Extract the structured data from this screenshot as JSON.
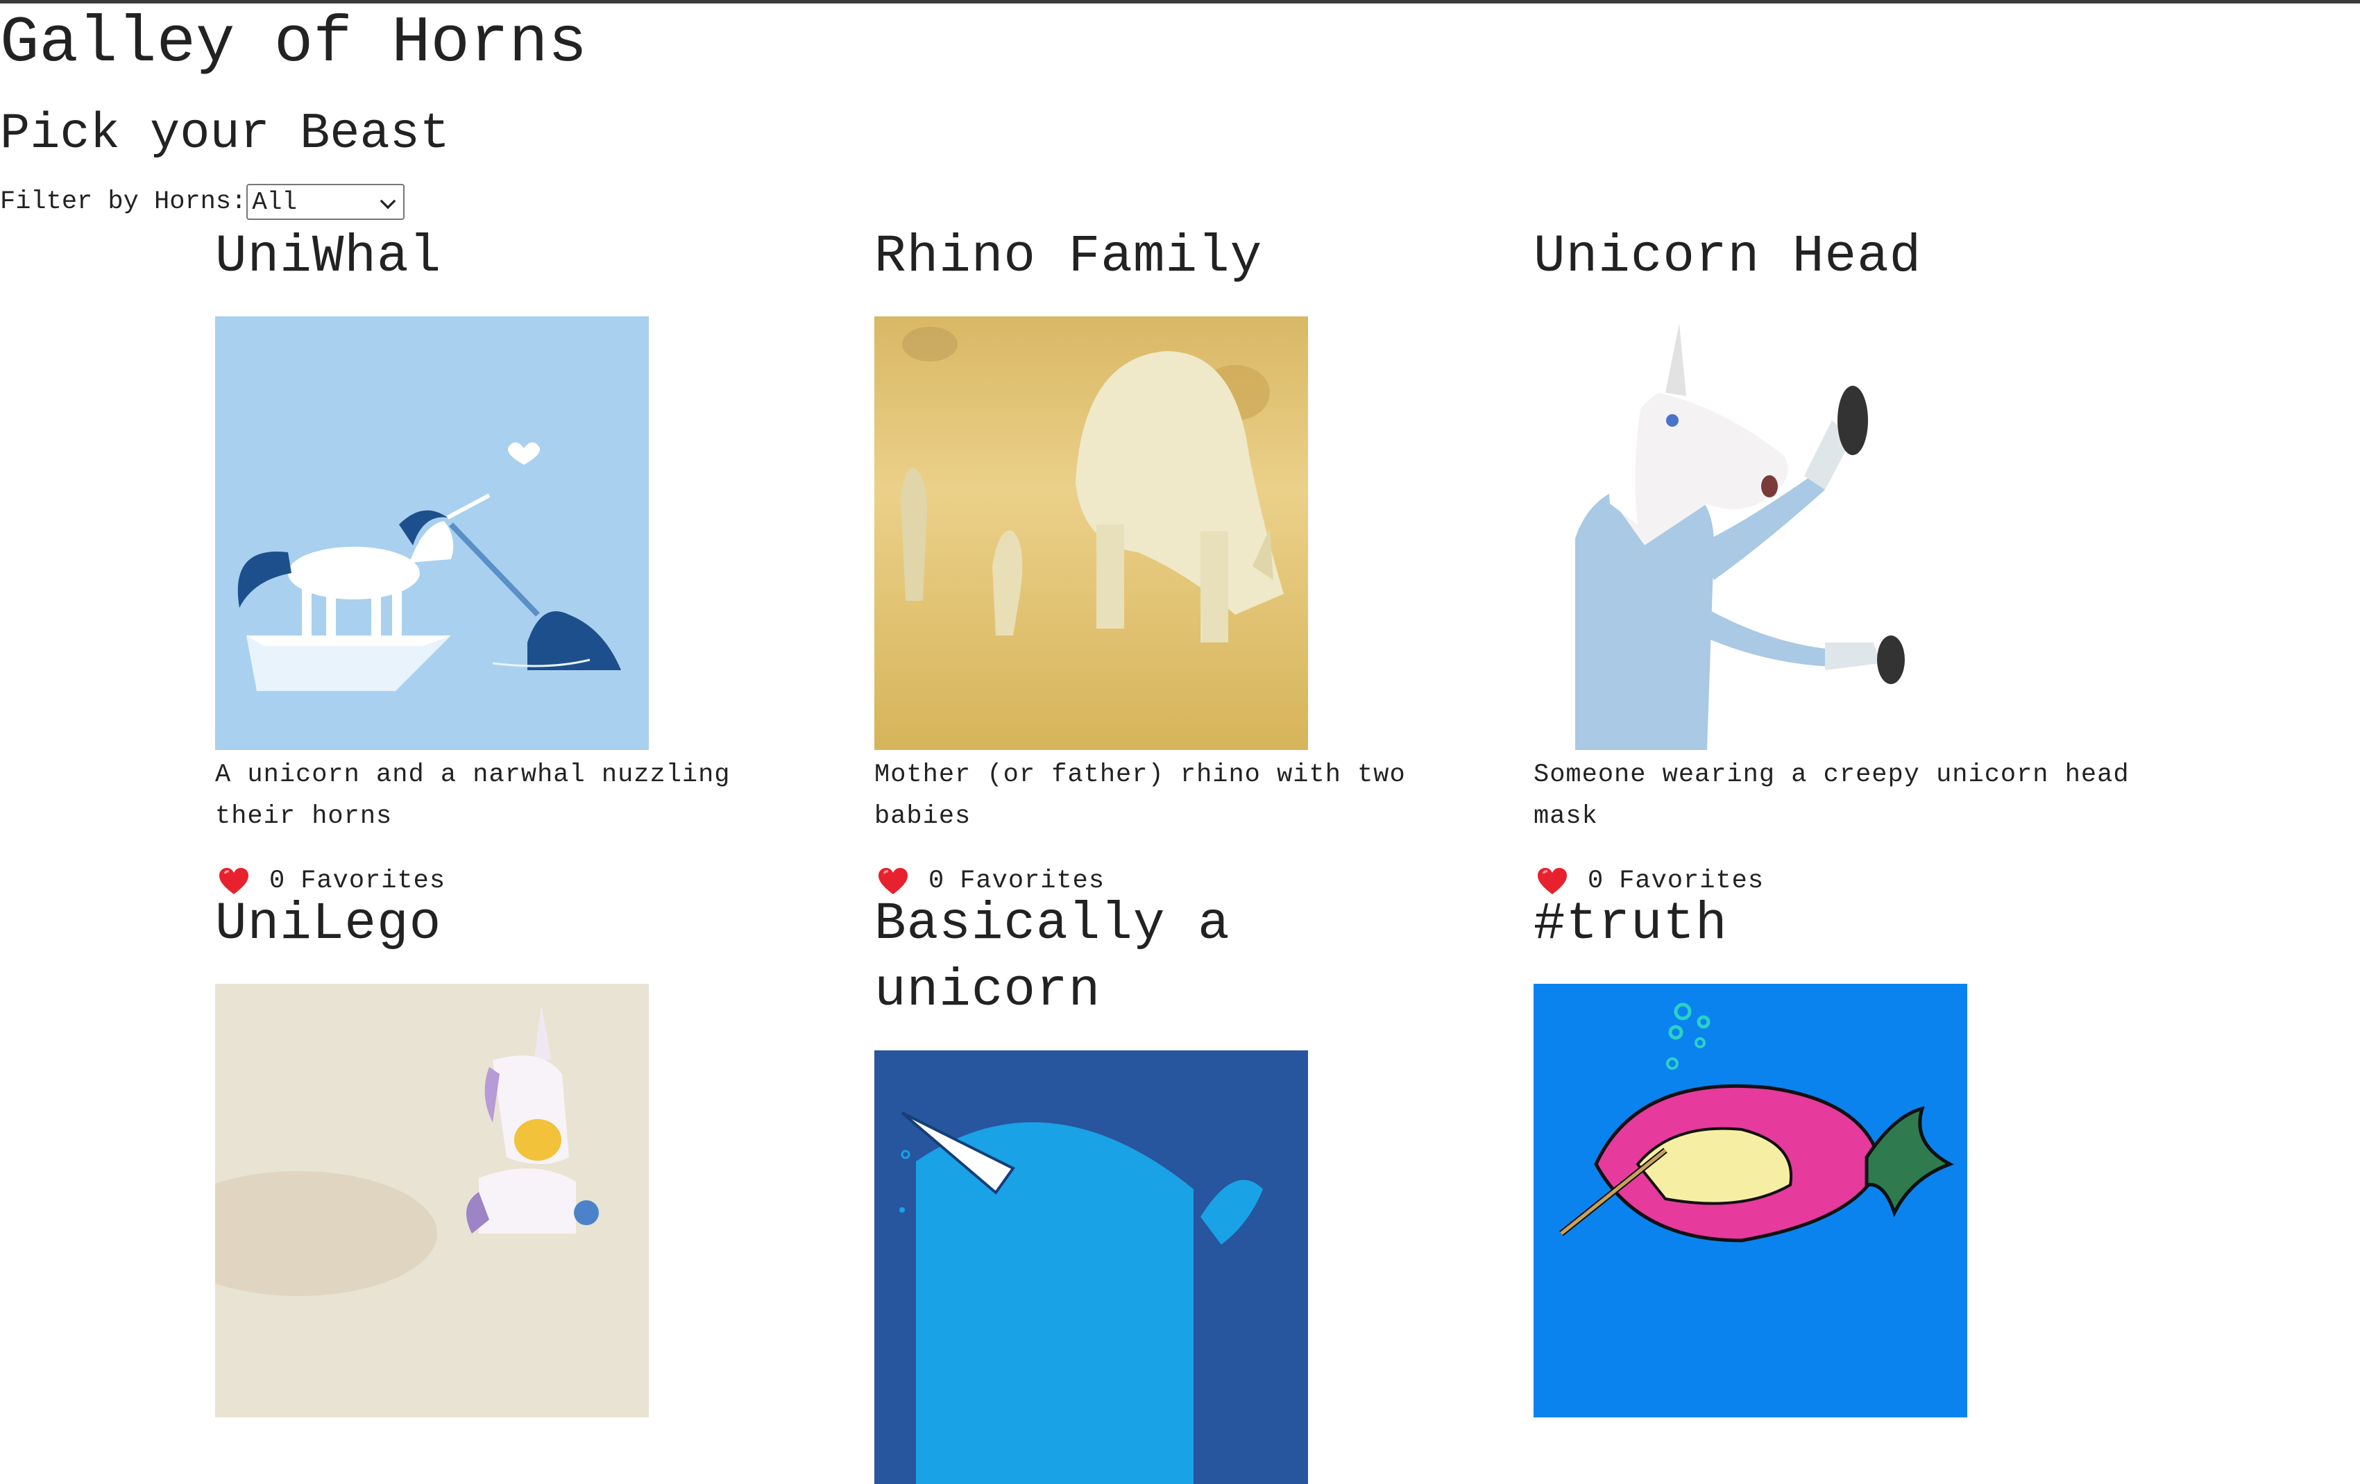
{
  "page": {
    "title": "Galley of Horns",
    "subtitle": "Pick your Beast"
  },
  "filter": {
    "label": "Filter by Horns:",
    "selected": "All"
  },
  "cards": [
    {
      "title": "UniWhal",
      "description": "A unicorn and a narwhal nuzzling their horns",
      "favorites": "0",
      "favorites_label": "Favorites"
    },
    {
      "title": "Rhino Family",
      "description": "Mother (or father) rhino with two babies",
      "favorites": "0",
      "favorites_label": "Favorites"
    },
    {
      "title": "Unicorn Head",
      "description": "Someone wearing a creepy unicorn head mask",
      "favorites": "0",
      "favorites_label": "Favorites"
    },
    {
      "title": "UniLego"
    },
    {
      "title": "Basically a unicorn"
    },
    {
      "title": "#truth"
    }
  ],
  "icons": {
    "favorite": "heart-icon",
    "dropdown": "chevron-down-icon"
  },
  "colors": {
    "heart": "#e8212e",
    "uniwhal_bg": "#a9d0ee",
    "rhino_bg": "#e6c978",
    "narwhal_bg": "#27559e",
    "truth_bg": "#0a83ef"
  }
}
